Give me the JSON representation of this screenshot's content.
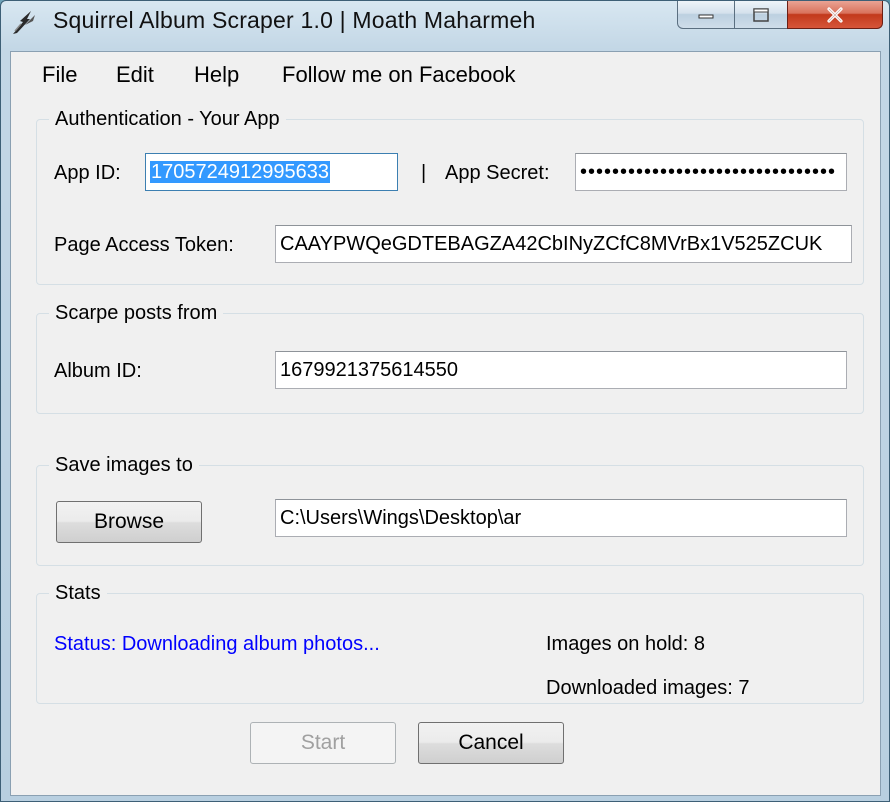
{
  "window": {
    "title": "Squirrel Album Scraper 1.0 | Moath Maharmeh",
    "controls": {
      "minimize_icon": "minimize-icon",
      "maximize_icon": "maximize-icon",
      "close_icon": "close-icon"
    }
  },
  "menu": {
    "file": "File",
    "edit": "Edit",
    "help": "Help",
    "facebook": "Follow me on Facebook"
  },
  "auth": {
    "title": "Authentication - Your App",
    "app_id_label": "App ID:",
    "app_id_value": "1705724912995633",
    "separator": "|",
    "app_secret_label": "App Secret:",
    "app_secret_value": "••••••••••••••••••••••••••••••••",
    "token_label": "Page Access Token:",
    "token_value": "CAAYPWQeGDTEBAGZA42CbINyZCfC8MVrBx1V525ZCUK"
  },
  "scrape": {
    "title": "Scarpe posts from",
    "album_label": "Album ID:",
    "album_value": "1679921375614550"
  },
  "save": {
    "title": "Save images to",
    "browse_label": "Browse",
    "path_value": "C:\\Users\\Wings\\Desktop\\ar"
  },
  "stats": {
    "title": "Stats",
    "status": "Status: Downloading album photos...",
    "on_hold": "Images on hold: 8",
    "downloaded": "Downloaded images: 7"
  },
  "actions": {
    "start_label": "Start",
    "cancel_label": "Cancel"
  },
  "colors": {
    "status_text": "#0000ff",
    "selection": "#3399ff",
    "close_button": "#c2391c"
  }
}
